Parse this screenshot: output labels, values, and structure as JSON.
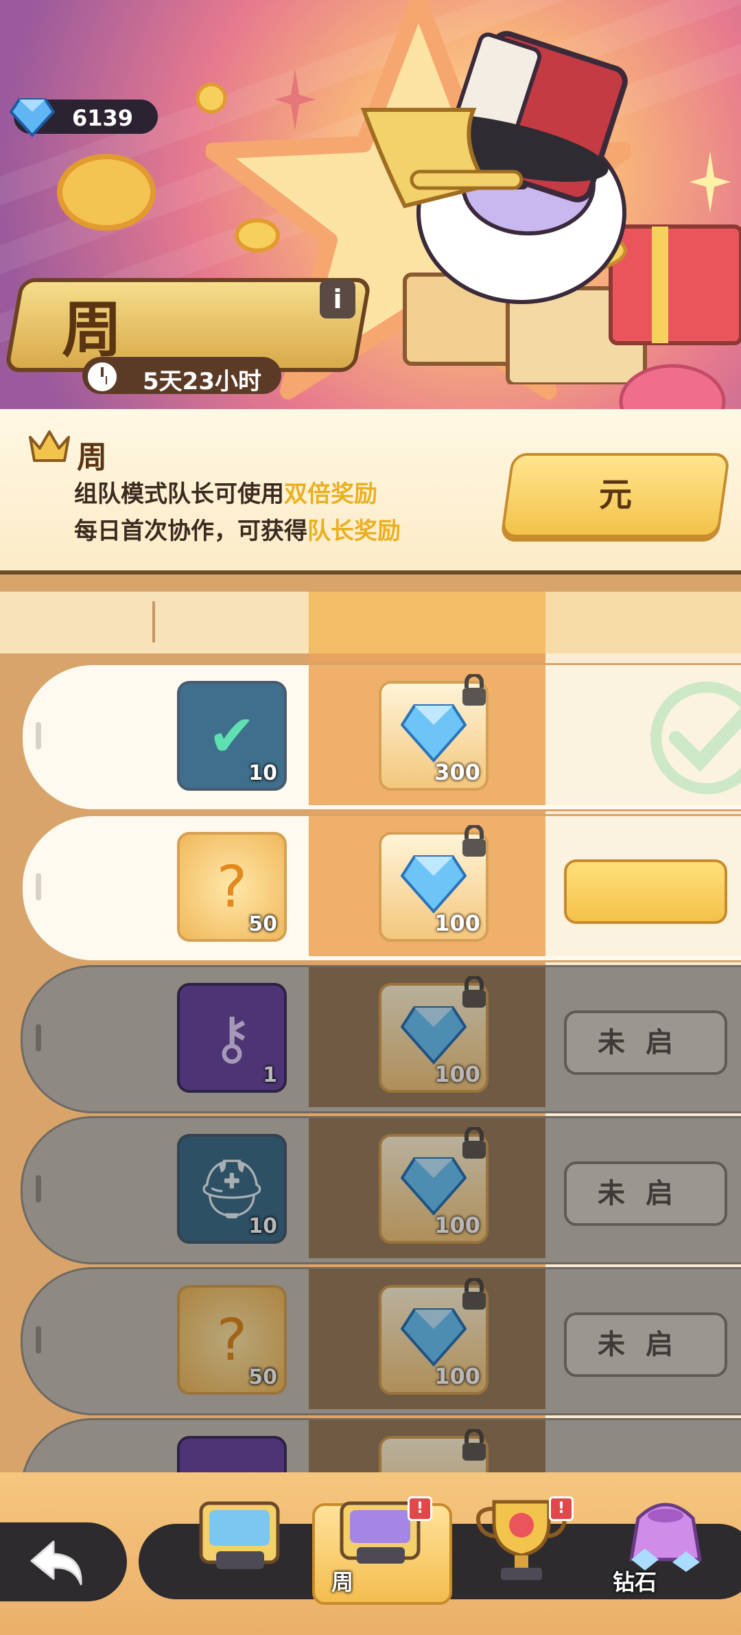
{
  "header": {
    "gem_count": "6139",
    "title": "周",
    "timer": "5天23小时",
    "info_icon": "info-icon"
  },
  "info_strip": {
    "title": "周",
    "line1_prefix": "组队模式队长可使用",
    "line1_highlight": "双倍奖励",
    "line2_prefix": "每日首次协作，可获得",
    "line2_highlight": "队长奖励",
    "action_label": "元",
    "highlight_color": "#e9b020"
  },
  "rows": [
    {
      "free_icon": "map-check-icon",
      "free_qty": "10",
      "reward_icon": "diamond-icon",
      "reward_qty": "300",
      "status": "claimed"
    },
    {
      "free_icon": "mystery-bottle-icon",
      "free_qty": "50",
      "reward_icon": "diamond-icon",
      "reward_qty": "100",
      "status": "claimable"
    },
    {
      "free_icon": "hammer-key-icon",
      "free_qty": "1",
      "reward_icon": "diamond-icon",
      "reward_qty": "100",
      "status": "locked",
      "status_label": "未启"
    },
    {
      "free_icon": "helmet-map-icon",
      "free_qty": "10",
      "reward_icon": "diamond-icon",
      "reward_qty": "100",
      "status": "locked",
      "status_label": "未启"
    },
    {
      "free_icon": "mystery-bottle-icon",
      "free_qty": "50",
      "reward_icon": "diamond-icon",
      "reward_qty": "100",
      "status": "locked",
      "status_label": "未启"
    }
  ],
  "bottom_nav": {
    "back_icon": "back-arrow-icon",
    "tabs": [
      {
        "icon": "blue-pass-icon",
        "label": ""
      },
      {
        "icon": "purple-pass-icon",
        "label": "周",
        "badge": "!"
      },
      {
        "icon": "trophy-icon",
        "label": "",
        "badge": "!"
      },
      {
        "icon": "diamond-bag-icon",
        "label": "钻石"
      }
    ]
  }
}
